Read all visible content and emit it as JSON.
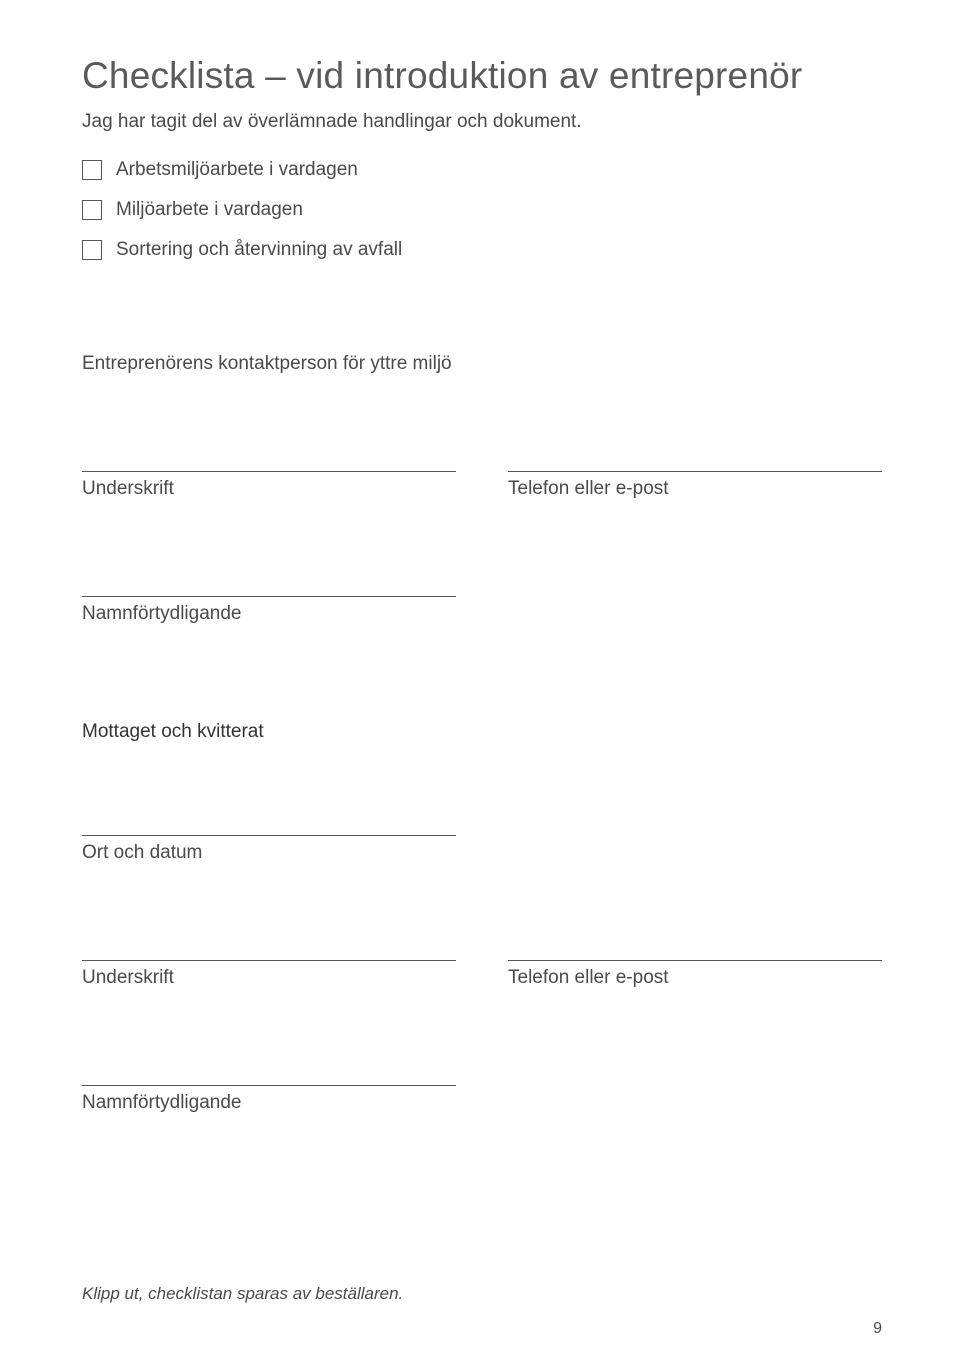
{
  "title": "Checklista – vid introduktion av entreprenör",
  "subheading": "Jag har tagit del av överlämnade handlingar och dokument.",
  "checklist": [
    {
      "label": "Arbetsmiljöarbete i vardagen"
    },
    {
      "label": "Miljöarbete i vardagen"
    },
    {
      "label": "Sortering och återvinning av avfall"
    }
  ],
  "contact_heading": "Entreprenörens kontaktperson för yttre miljö",
  "signature1": {
    "left": "Underskrift",
    "right": "Telefon eller e-post"
  },
  "name_clarify1": "Namnförtydligande",
  "received_heading": "Mottaget och kvitterat",
  "ort_datum": "Ort och datum",
  "signature2": {
    "left": "Underskrift",
    "right": "Telefon eller e-post"
  },
  "name_clarify2": "Namnförtydligande",
  "footnote": "Klipp ut, checklistan sparas av beställaren.",
  "page_number": "9"
}
